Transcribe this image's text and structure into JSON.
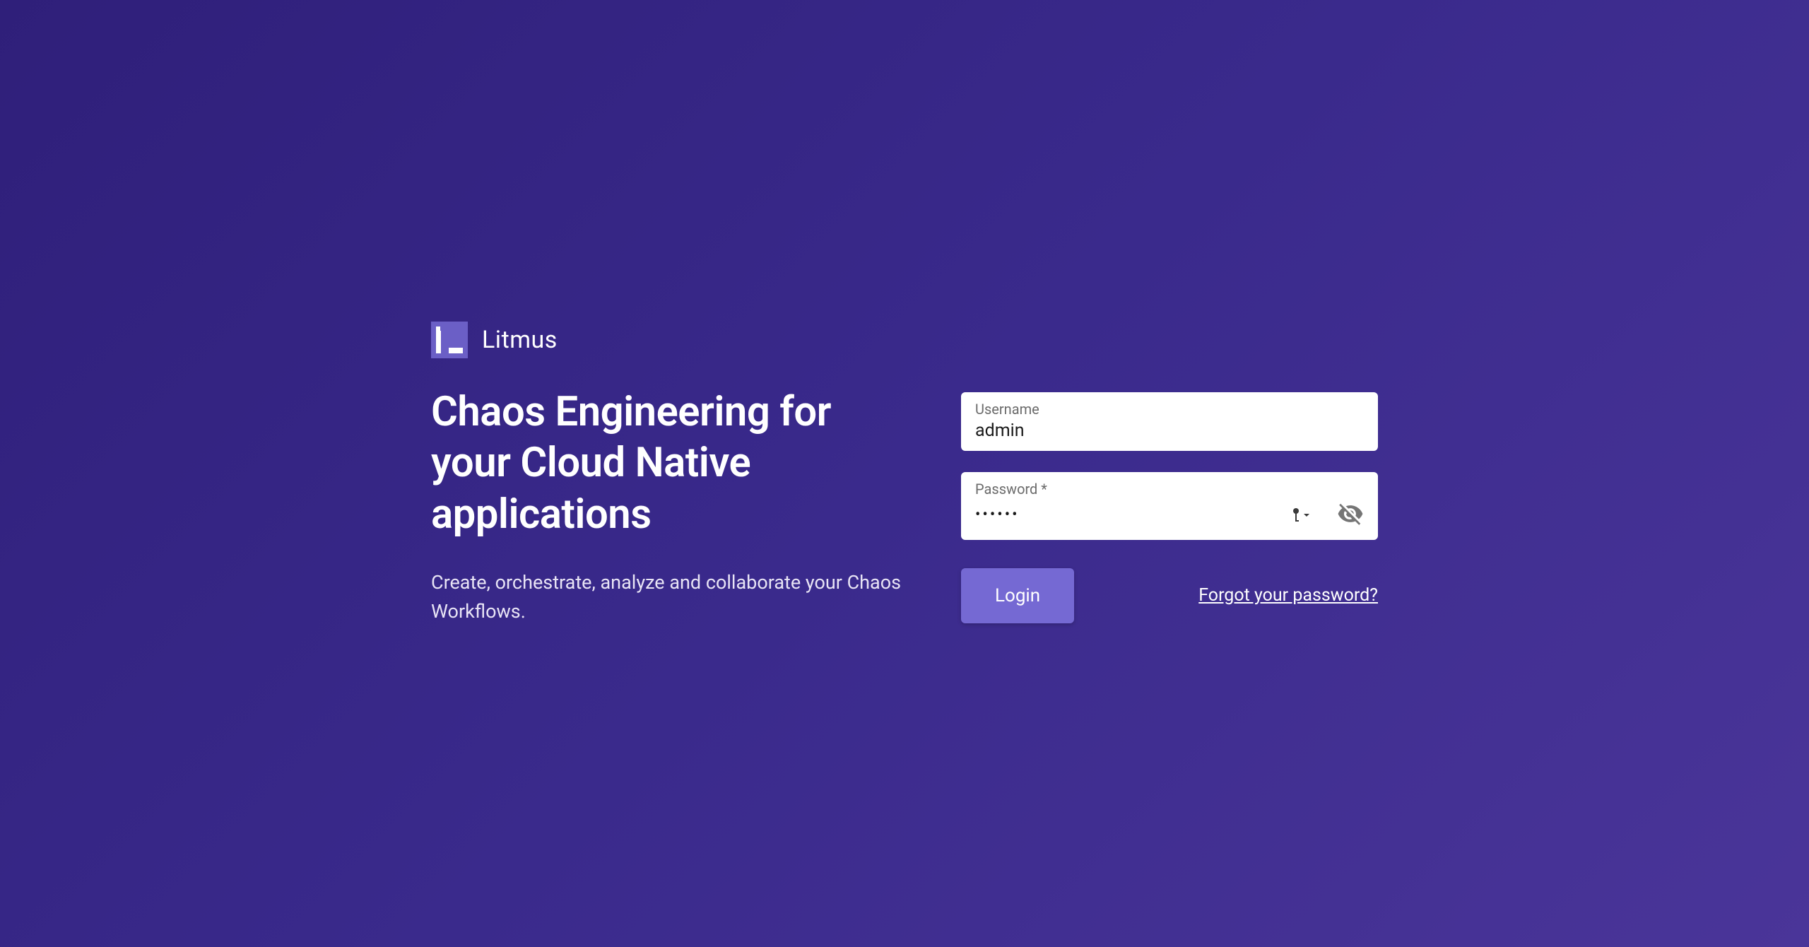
{
  "brand": {
    "name": "Litmus"
  },
  "hero": {
    "headline": "Chaos Engineering for your Cloud Native applications",
    "subhead": "Create, orchestrate, analyze and collaborate your Chaos Workflows."
  },
  "form": {
    "username": {
      "label": "Username",
      "value": "admin"
    },
    "password": {
      "label": "Password *",
      "value": "••••••"
    },
    "login_button": "Login",
    "forgot_link": "Forgot your password?"
  }
}
